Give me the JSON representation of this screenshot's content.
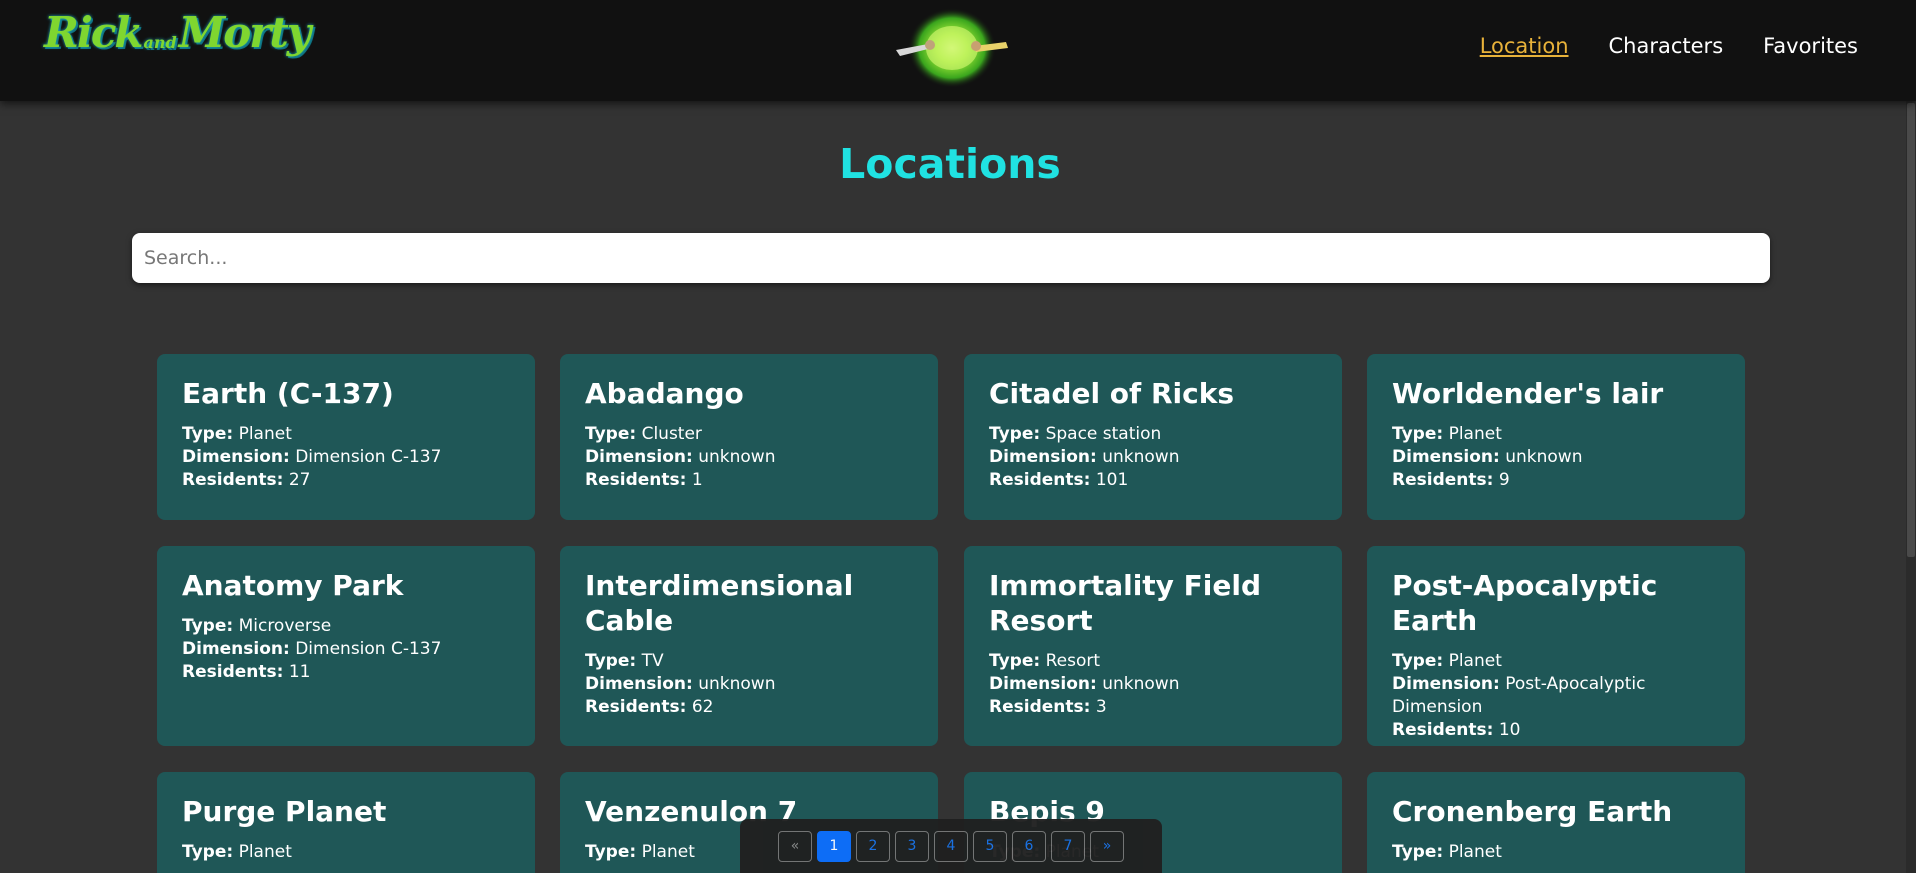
{
  "brand": {
    "logo_text_1": "Rick",
    "logo_text_2": "and",
    "logo_text_3": "Morty",
    "colors": {
      "green": "#7fd630",
      "teal": "#1fb0c0"
    }
  },
  "nav": {
    "items": [
      {
        "label": "Location",
        "active": true
      },
      {
        "label": "Characters",
        "active": false
      },
      {
        "label": "Favorites",
        "active": false
      }
    ]
  },
  "page": {
    "title": "Locations",
    "search_placeholder": "Search..."
  },
  "labels": {
    "type": "Type:",
    "dimension": "Dimension:",
    "residents": "Residents:"
  },
  "locations": [
    {
      "name": "Earth (C-137)",
      "type": "Planet",
      "dimension": "Dimension C-137",
      "residents": "27"
    },
    {
      "name": "Abadango",
      "type": "Cluster",
      "dimension": "unknown",
      "residents": "1"
    },
    {
      "name": "Citadel of Ricks",
      "type": "Space station",
      "dimension": "unknown",
      "residents": "101"
    },
    {
      "name": "Worldender's lair",
      "type": "Planet",
      "dimension": "unknown",
      "residents": "9"
    },
    {
      "name": "Anatomy Park",
      "type": "Microverse",
      "dimension": "Dimension C-137",
      "residents": "11"
    },
    {
      "name": "Interdimensional Cable",
      "type": "TV",
      "dimension": "unknown",
      "residents": "62"
    },
    {
      "name": "Immortality Field Resort",
      "type": "Resort",
      "dimension": "unknown",
      "residents": "3"
    },
    {
      "name": "Post-Apocalyptic Earth",
      "type": "Planet",
      "dimension": "Post-Apocalyptic Dimension",
      "residents": "10"
    },
    {
      "name": "Purge Planet",
      "type": "Planet"
    },
    {
      "name": "Venzenulon 7",
      "type": "Planet"
    },
    {
      "name": "Bepis 9",
      "type": "Planet"
    },
    {
      "name": "Cronenberg Earth",
      "type": "Planet"
    }
  ],
  "pagination": {
    "prev": "«",
    "next": "»",
    "pages": [
      "1",
      "2",
      "3",
      "4",
      "5",
      "6",
      "7"
    ],
    "current": "1"
  },
  "colors": {
    "background": "#333333",
    "card": "#1f5757",
    "title": "#20e2e2",
    "nav_active": "#e8b23a",
    "page_active": "#0d6efd"
  }
}
